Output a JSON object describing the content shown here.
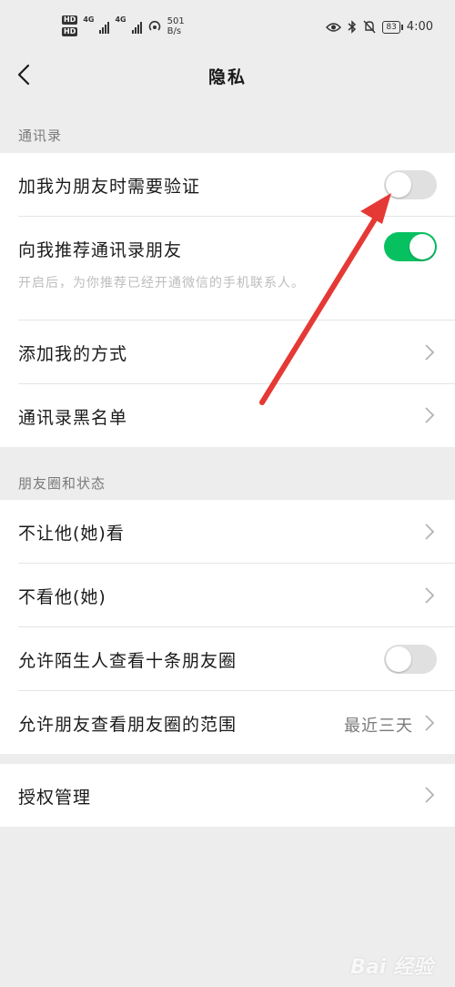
{
  "status_bar": {
    "hd1": "HD",
    "hd2": "HD",
    "net1": "4G",
    "net2": "4G",
    "speed_value": "501",
    "speed_unit": "B/s",
    "battery": "83",
    "time": "4:00"
  },
  "header": {
    "title": "隐私"
  },
  "sections": {
    "contacts": {
      "label": "通讯录",
      "rows": [
        {
          "label": "加我为朋友时需要验证",
          "toggle": "off"
        },
        {
          "label": "向我推荐通讯录朋友",
          "toggle": "on",
          "sub": "开启后，为你推荐已经开通微信的手机联系人。"
        },
        {
          "label": "添加我的方式"
        },
        {
          "label": "通讯录黑名单"
        }
      ]
    },
    "moments": {
      "label": "朋友圈和状态",
      "rows": [
        {
          "label": "不让他(她)看"
        },
        {
          "label": "不看他(她)"
        },
        {
          "label": "允许陌生人查看十条朋友圈",
          "toggle": "off"
        },
        {
          "label": "允许朋友查看朋友圈的范围",
          "value": "最近三天"
        }
      ]
    },
    "auth": {
      "rows": [
        {
          "label": "授权管理"
        }
      ]
    }
  },
  "watermark": "Bai 经验",
  "colors": {
    "toggle_on": "#07c160",
    "toggle_off": "#e0e0e0",
    "annotation_arrow": "#e53935",
    "background": "#ededed"
  }
}
